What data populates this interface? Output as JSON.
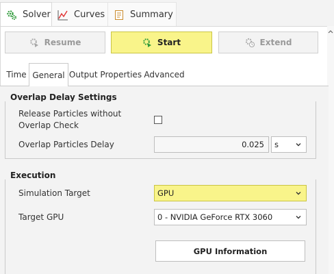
{
  "top_tabs": [
    {
      "label": "Solver",
      "icon": "gears-icon"
    },
    {
      "label": "Curves",
      "icon": "chart-line-icon"
    },
    {
      "label": "Summary",
      "icon": "summary-document-icon"
    }
  ],
  "actions": {
    "resume_label": "Resume",
    "start_label": "Start",
    "extend_label": "Extend"
  },
  "sub_tabs": [
    "Time",
    "General",
    "Output Properties",
    "Advanced"
  ],
  "overlap": {
    "title": "Overlap Delay Settings",
    "release_label": "Release Particles without Overlap Check",
    "release_checked": false,
    "delay_label": "Overlap Particles Delay",
    "delay_value": "0.025",
    "delay_unit": "s"
  },
  "execution": {
    "title": "Execution",
    "target_label": "Simulation Target",
    "target_value": "GPU",
    "gpu_label": "Target GPU",
    "gpu_value": "0 - NVIDIA GeForce RTX 3060",
    "gpu_info_label": "GPU Information"
  },
  "colors": {
    "highlight": "#f9f48a",
    "highlight_border": "#c9c443",
    "accent_green": "#2f9a3a"
  }
}
